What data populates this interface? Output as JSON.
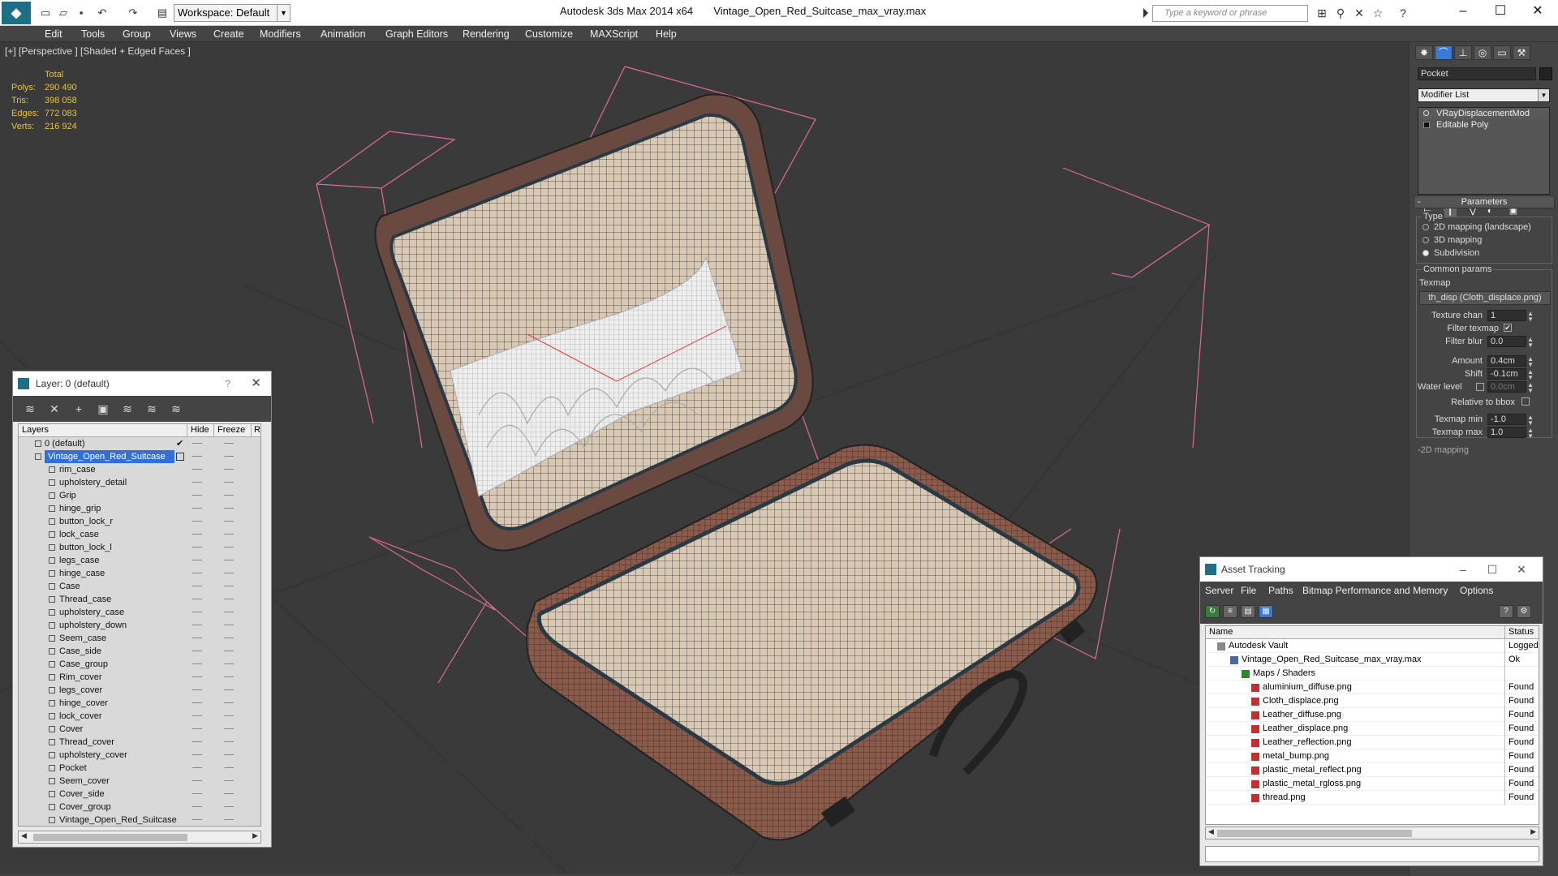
{
  "titlebar": {
    "workspace": "Workspace: Default",
    "app_title": "Autodesk 3ds Max  2014 x64",
    "file_title": "Vintage_Open_Red_Suitcase_max_vray.max",
    "search_placeholder": "Type a keyword or phrase"
  },
  "menu": [
    "Edit",
    "Tools",
    "Group",
    "Views",
    "Create",
    "Modifiers",
    "Animation",
    "Graph Editors",
    "Rendering",
    "Customize",
    "MAXScript",
    "Help"
  ],
  "viewport": {
    "label": "[+] [Perspective ] [Shaded + Edged Faces ]",
    "stats": {
      "header": "Total",
      "polys_label": "Polys:",
      "polys": "290 490",
      "tris_label": "Tris:",
      "tris": "398 058",
      "edges_label": "Edges:",
      "edges": "772 083",
      "verts_label": "Verts:",
      "verts": "216 924"
    }
  },
  "layer_dialog": {
    "title": "Layer: 0 (default)",
    "help": "?",
    "columns": {
      "layers": "Layers",
      "hide": "Hide",
      "freeze": "Freeze",
      "render": "R"
    },
    "default_layer": "0 (default)",
    "selected_layer": "Vintage_Open_Red_Suitcase",
    "children": [
      "rim_case",
      "upholstery_detail",
      "Grip",
      "hinge_grip",
      "button_lock_r",
      "lock_case",
      "button_lock_l",
      "legs_case",
      "hinge_case",
      "Case",
      "Thread_case",
      "upholstery_case",
      "upholstery_down",
      "Seem_case",
      "Case_side",
      "Case_group",
      "Rim_cover",
      "legs_cover",
      "hinge_cover",
      "lock_cover",
      "Cover",
      "Thread_cover",
      "upholstery_cover",
      "Pocket",
      "Seem_cover",
      "Cover_side",
      "Cover_group",
      "Vintage_Open_Red_Suitcase"
    ]
  },
  "command_panel": {
    "object_name": "Pocket",
    "modifier_list": "Modifier List",
    "stack": [
      "VRayDisplacementMod",
      "Editable Poly"
    ],
    "parameters_title": "Parameters",
    "type_title": "Type",
    "types": [
      "2D mapping (landscape)",
      "3D mapping",
      "Subdivision"
    ],
    "selected_type": "Subdivision",
    "common_title": "Common params",
    "texmap_label": "Texmap",
    "texmap_value": "th_disp (Cloth_displace.png)",
    "texture_chan_label": "Texture chan",
    "texture_chan": "1",
    "filter_texmap_label": "Filter texmap",
    "filter_texmap_checked": true,
    "filter_blur_label": "Filter blur",
    "filter_blur": "0.0",
    "amount_label": "Amount",
    "amount": "0.4cm",
    "shift_label": "Shift",
    "shift": "-0.1cm",
    "water_level_label": "Water level",
    "water_level": "0.0cm",
    "relative_bbox_label": "Relative to bbox",
    "texmap_min_label": "Texmap min",
    "texmap_min": "-1.0",
    "texmap_max_label": "Texmap max",
    "texmap_max": "1.0",
    "next_rollout": "2D mapping"
  },
  "asset_dialog": {
    "title": "Asset Tracking",
    "menu": [
      "Server",
      "File",
      "Paths",
      "Bitmap Performance and Memory",
      "Options"
    ],
    "columns": {
      "name": "Name",
      "status": "Status"
    },
    "rows": [
      {
        "name": "Autodesk Vault",
        "status": "Logged Out",
        "level": 0
      },
      {
        "name": "Vintage_Open_Red_Suitcase_max_vray.max",
        "status": "Ok",
        "level": 1
      },
      {
        "name": "Maps / Shaders",
        "status": "",
        "level": 2
      },
      {
        "name": "aluminium_diffuse.png",
        "status": "Found",
        "level": 3
      },
      {
        "name": "Cloth_displace.png",
        "status": "Found",
        "level": 3
      },
      {
        "name": "Leather_diffuse.png",
        "status": "Found",
        "level": 3
      },
      {
        "name": "Leather_displace.png",
        "status": "Found",
        "level": 3
      },
      {
        "name": "Leather_reflection.png",
        "status": "Found",
        "level": 3
      },
      {
        "name": "metal_bump.png",
        "status": "Found",
        "level": 3
      },
      {
        "name": "plastic_metal_reflect.png",
        "status": "Found",
        "level": 3
      },
      {
        "name": "plastic_metal_rgloss.png",
        "status": "Found",
        "level": 3
      },
      {
        "name": "thread.png",
        "status": "Found",
        "level": 3
      }
    ]
  },
  "colors": {
    "accent": "#1e6e86",
    "selection": "#3070d8",
    "stats": "#e8c040",
    "bbox": "#e06a9a",
    "leather": "#8a5a4a",
    "lining": "#d8c8b4"
  }
}
